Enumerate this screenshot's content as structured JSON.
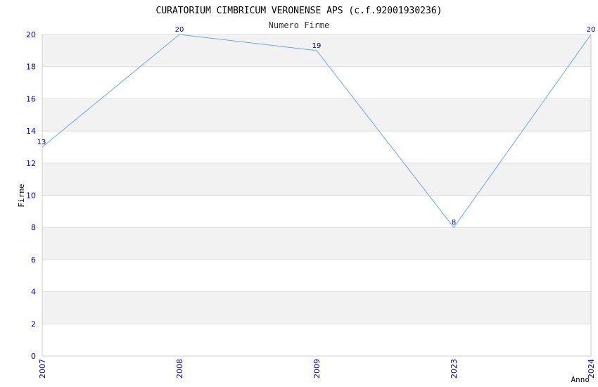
{
  "chart_data": {
    "type": "line",
    "title": "CURATORIUM CIMBRICUM VERONENSE APS (c.f.92001930236)",
    "subtitle": "Numero Firme",
    "xlabel": "Anno",
    "ylabel": "Firme",
    "categories": [
      "2007",
      "2008",
      "2009",
      "2023",
      "2024"
    ],
    "series": [
      {
        "values": [
          13,
          20,
          19,
          8,
          20
        ]
      }
    ],
    "ylim": [
      0,
      20
    ],
    "yticks": [
      0,
      2,
      4,
      6,
      8,
      10,
      12,
      14,
      16,
      18,
      20
    ],
    "grid": true,
    "colors": {
      "line": "#66aaee",
      "band": "#f2f2f2",
      "grid": "#dddddd",
      "tick_text": "#0000cc",
      "data_label": "#000080"
    }
  }
}
